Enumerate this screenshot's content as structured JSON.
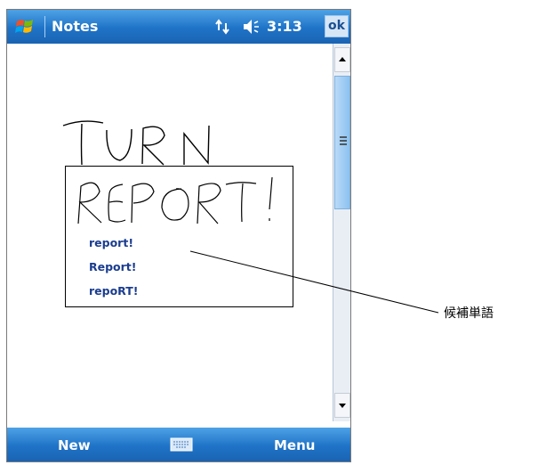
{
  "titlebar": {
    "app_title": "Notes",
    "time": "3:13",
    "ok_label": "ok"
  },
  "icons": {
    "start": "windows-flag-icon",
    "connectivity": "sync-arrows-icon",
    "volume": "speaker-icon",
    "keyboard": "keyboard-icon"
  },
  "note": {
    "handwriting_1": "TURN",
    "handwriting_2": "REPORT!"
  },
  "candidates": {
    "items": [
      "report!",
      "Report!",
      "repoRT!"
    ]
  },
  "bottombar": {
    "new_label": "New",
    "menu_label": "Menu"
  },
  "callout": {
    "label": "候補単語"
  },
  "colors": {
    "bar": "#1f73c7",
    "candidate_text": "#1b3d8f"
  }
}
